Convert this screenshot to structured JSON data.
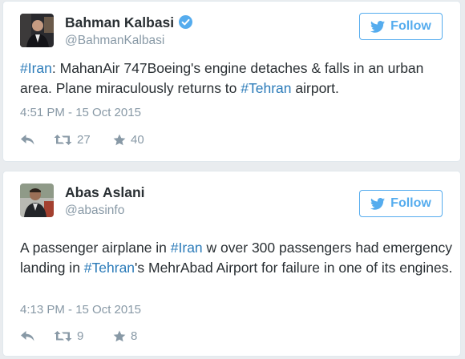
{
  "tweets": [
    {
      "name": "Bahman Kalbasi",
      "handle": "@BahmanKalbasi",
      "verified": true,
      "follow_label": "Follow",
      "text_segments": [
        {
          "text": "#Iran",
          "hashtag": true
        },
        {
          "text": ": MahanAir 747Boeing's engine detaches & falls in an urban area. Plane miraculously returns to ",
          "hashtag": false
        },
        {
          "text": "#Tehran",
          "hashtag": true
        },
        {
          "text": " airport.",
          "hashtag": false
        }
      ],
      "timestamp": "4:51 PM - 15 Oct 2015",
      "retweets": "27",
      "favorites": "40"
    },
    {
      "name": "Abas Aslani",
      "handle": "@abasinfo",
      "verified": false,
      "follow_label": "Follow",
      "text_segments": [
        {
          "text": "A passenger airplane in ",
          "hashtag": false
        },
        {
          "text": "#Iran",
          "hashtag": true
        },
        {
          "text": " w over 300 passengers had emergency landing in ",
          "hashtag": false
        },
        {
          "text": "#Tehran",
          "hashtag": true
        },
        {
          "text": "'s MehrAbad Airport for failure in one of its engines.",
          "hashtag": false
        }
      ],
      "timestamp": "4:13 PM - 15 Oct 2015",
      "retweets": "9",
      "favorites": "8"
    }
  ],
  "icons": {
    "twitter_bird": "twitter-bird-icon",
    "verified": "verified-badge-icon",
    "reply": "reply-icon",
    "retweet": "retweet-icon",
    "favorite": "star-icon"
  },
  "colors": {
    "background": "#e9ecef",
    "card": "#ffffff",
    "text": "#292f33",
    "muted": "#8899a6",
    "link": "#2b7bb9",
    "accent": "#55acee"
  }
}
